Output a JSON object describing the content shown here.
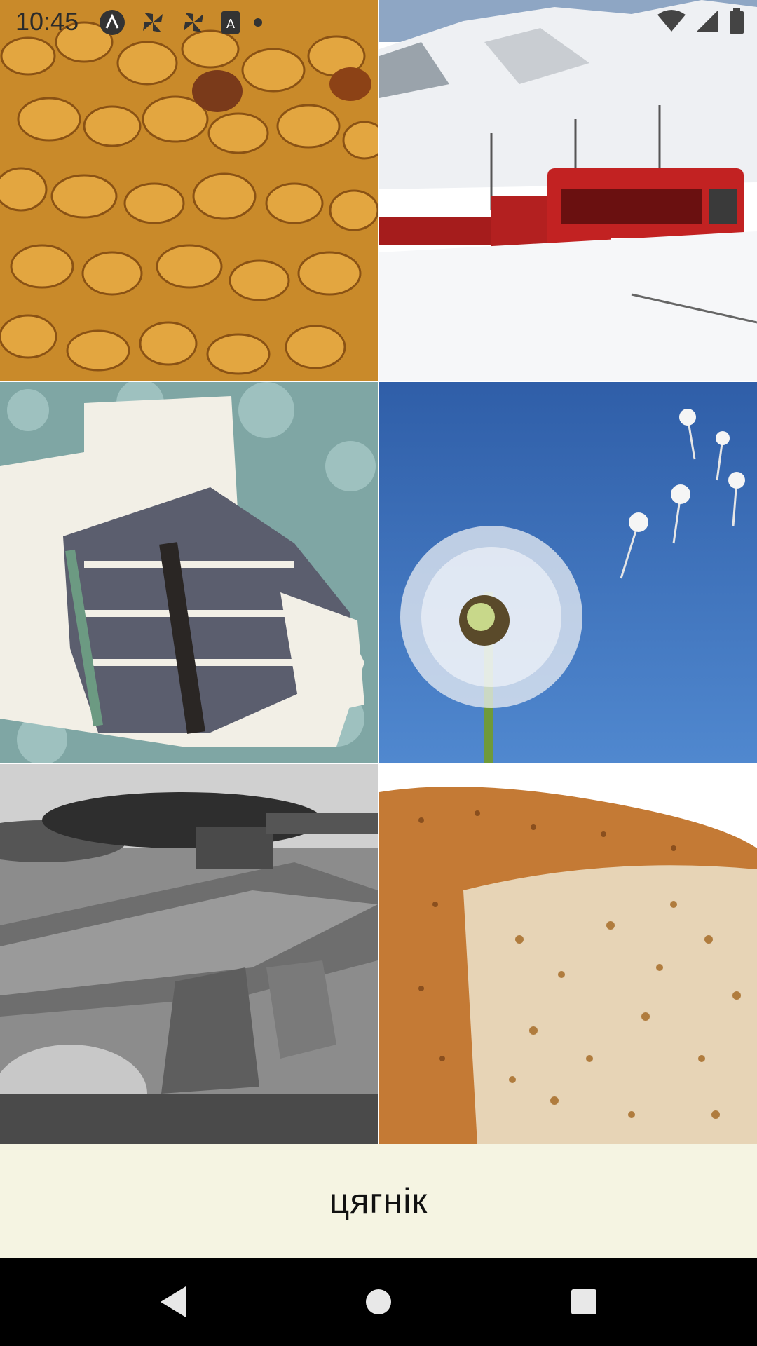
{
  "status_bar": {
    "time": "10:45",
    "left_icons": [
      "app-a-icon",
      "pinwheel-icon",
      "pinwheel-icon",
      "translate-icon",
      "dot-icon"
    ],
    "right_icons": [
      "wifi-icon",
      "signal-icon",
      "battery-icon"
    ]
  },
  "grid": {
    "tiles": [
      {
        "subject": "raisins"
      },
      {
        "subject": "train"
      },
      {
        "subject": "socks"
      },
      {
        "subject": "dandelion"
      },
      {
        "subject": "anvil"
      },
      {
        "subject": "bread"
      }
    ]
  },
  "answer": {
    "word": "цягнік"
  },
  "nav": {
    "buttons": [
      "back-icon",
      "home-icon",
      "recents-icon"
    ]
  },
  "colors": {
    "answer_bg": "#f5f4e2",
    "nav_bg": "#000000"
  }
}
